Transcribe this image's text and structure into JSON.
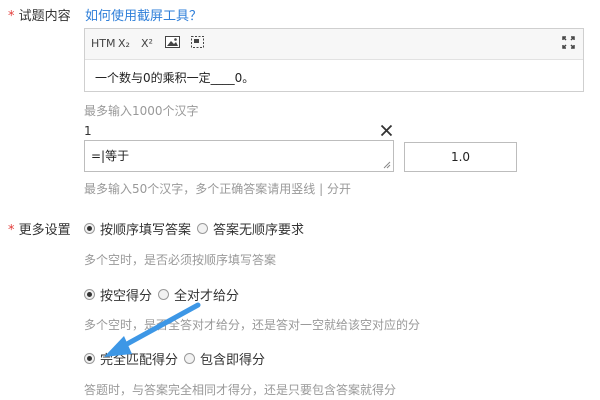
{
  "question_content": {
    "label": "试题内容",
    "required_mark": "*",
    "help_link": "如何使用截屏工具？",
    "toolbar": {
      "html_label": "HTM",
      "subscript_label": "X₂",
      "superscript_label": "X²",
      "image_icon": "image-icon",
      "screenshot_icon": "screenshot-icon",
      "fullscreen_icon": "fullscreen-icon"
    },
    "content": "一个数与0的乘积一定____0。",
    "hint": "最多输入1000个汉字"
  },
  "blank": {
    "number": "1",
    "answer_text": "=|等于",
    "score": "1.0",
    "hint": "最多输入50个汉字，多个正确答案请用竖线 | 分开"
  },
  "more_settings": {
    "label": "更多设置",
    "required_mark": "*",
    "order_group": {
      "options": [
        "按顺序填写答案",
        "答案无顺序要求"
      ],
      "selected": 0,
      "hint": "多个空时，是否必须按顺序填写答案"
    },
    "score_group": {
      "options": [
        "按空得分",
        "全对才给分"
      ],
      "selected": 0,
      "hint": "多个空时，是否全答对才给分，还是答对一空就给该空对应的分"
    },
    "match_group": {
      "options": [
        "完全匹配得分",
        "包含即得分"
      ],
      "selected": 0,
      "hint": "答题时，与答案完全相同才得分，还是只要包含答案就得分"
    }
  },
  "colors": {
    "accent": "#2f7fd9",
    "required": "#e23c39",
    "hint_text": "#999999",
    "arrow": "#3d97e6"
  }
}
